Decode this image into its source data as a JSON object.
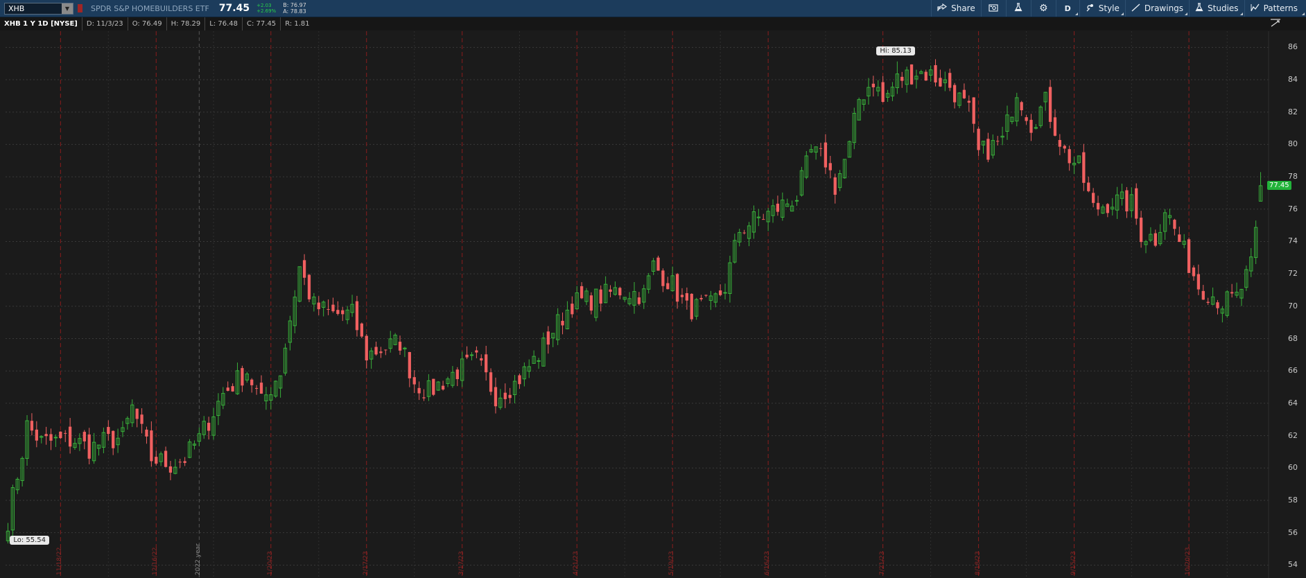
{
  "toolbar": {
    "symbol": "XHB",
    "company": "SPDR S&P HOMEBUILDERS ETF",
    "last": "77.45",
    "change": "+2.03",
    "change_pct": "+2.69%",
    "bid": "B: 76.97",
    "ask": "A: 78.83",
    "share_label": "Share",
    "aggregation": "D",
    "style_label": "Style",
    "drawings_label": "Drawings",
    "studies_label": "Studies",
    "patterns_label": "Patterns"
  },
  "info": {
    "title": "XHB 1 Y 1D [NYSE]",
    "date": "D: 11/3/23",
    "open": "O: 76.49",
    "high": "H: 78.29",
    "low": "L: 76.48",
    "close": "C: 77.45",
    "range": "R: 1.81"
  },
  "colors": {
    "up": "#38b03a",
    "down": "#f06060",
    "grid": "#3a3a3a",
    "month_line": "#8a1c1c",
    "toolbar_bg": "#1c3c5c"
  },
  "chart_data": {
    "type": "candlestick",
    "ylim": [
      53.2,
      87
    ],
    "yticks": [
      54,
      56,
      58,
      60,
      62,
      64,
      66,
      68,
      70,
      72,
      74,
      76,
      78,
      80,
      82,
      84,
      86
    ],
    "ytick_labels": [
      "54",
      "56",
      "58",
      "60",
      "62",
      "64",
      "66",
      "68",
      "70",
      "72",
      "74",
      "76",
      "78",
      "80",
      "82",
      "84",
      "86"
    ],
    "month_labels": [
      {
        "label": "11/18/22",
        "index": 11
      },
      {
        "label": "12/16/22",
        "index": 31
      },
      {
        "label": "1/20/23",
        "index": 55
      },
      {
        "label": "2/17/23",
        "index": 75
      },
      {
        "label": "3/17/23",
        "index": 95
      },
      {
        "label": "4/21/23",
        "index": 119
      },
      {
        "label": "5/19/23",
        "index": 139
      },
      {
        "label": "6/16/23",
        "index": 159
      },
      {
        "label": "7/21/23",
        "index": 183
      },
      {
        "label": "8/18/23",
        "index": 203
      },
      {
        "label": "9/15/23",
        "index": 223
      },
      {
        "label": "10/20/23",
        "index": 247
      }
    ],
    "year_label": {
      "label": "2022 year",
      "index": 40
    },
    "high_label": "Hi: 85.13",
    "high_index": 186,
    "high_value": 85.13,
    "low_label": "Lo: 55.54",
    "low_index": 1,
    "low_value": 55.54,
    "last_label": "77.45",
    "last_value": 77.45,
    "waypoints": [
      [
        0,
        56.8
      ],
      [
        3,
        61.0
      ],
      [
        4,
        62.6
      ],
      [
        7,
        61.6
      ],
      [
        14,
        61.7
      ],
      [
        17,
        61.2
      ],
      [
        20,
        61.6
      ],
      [
        24,
        61.9
      ],
      [
        26,
        63.7
      ],
      [
        30,
        60.6
      ],
      [
        34,
        60.2
      ],
      [
        37,
        60.6
      ],
      [
        40,
        61.8
      ],
      [
        45,
        64.6
      ],
      [
        50,
        66.0
      ],
      [
        53,
        64.0
      ],
      [
        57,
        66.0
      ],
      [
        61,
        72.4
      ],
      [
        64,
        70.0
      ],
      [
        68,
        69.5
      ],
      [
        72,
        69.5
      ],
      [
        75,
        67.0
      ],
      [
        82,
        67.8
      ],
      [
        85,
        65.3
      ],
      [
        88,
        64.7
      ],
      [
        94,
        66.0
      ],
      [
        98,
        66.6
      ],
      [
        102,
        64.5
      ],
      [
        106,
        65.2
      ],
      [
        111,
        67.0
      ],
      [
        114,
        68.5
      ],
      [
        118,
        70.2
      ],
      [
        122,
        70.4
      ],
      [
        128,
        71.0
      ],
      [
        133,
        70.7
      ],
      [
        135,
        72.5
      ],
      [
        139,
        71.3
      ],
      [
        142,
        69.8
      ],
      [
        147,
        70.0
      ],
      [
        150,
        71.2
      ],
      [
        153,
        74.7
      ],
      [
        156,
        75.3
      ],
      [
        159,
        75.7
      ],
      [
        165,
        76.8
      ],
      [
        168,
        79.5
      ],
      [
        171,
        79.0
      ],
      [
        173,
        77.4
      ],
      [
        176,
        79.8
      ],
      [
        178,
        82.8
      ],
      [
        181,
        84.0
      ],
      [
        183,
        82.6
      ],
      [
        186,
        84.0
      ],
      [
        190,
        84.5
      ],
      [
        193,
        84.3
      ],
      [
        197,
        83.6
      ],
      [
        201,
        82.0
      ],
      [
        203,
        79.4
      ],
      [
        208,
        80.2
      ],
      [
        211,
        83.4
      ],
      [
        214,
        81.3
      ],
      [
        217,
        82.6
      ],
      [
        221,
        79.5
      ],
      [
        224,
        78.6
      ],
      [
        227,
        76.0
      ],
      [
        231,
        76.5
      ],
      [
        235,
        76.3
      ],
      [
        237,
        74.5
      ],
      [
        240,
        74.2
      ],
      [
        242,
        76.1
      ],
      [
        245,
        74.0
      ],
      [
        249,
        71.3
      ],
      [
        252,
        70.7
      ],
      [
        254,
        70.2
      ],
      [
        257,
        70.5
      ],
      [
        260,
        72.4
      ],
      [
        262,
        76.5
      ]
    ]
  }
}
